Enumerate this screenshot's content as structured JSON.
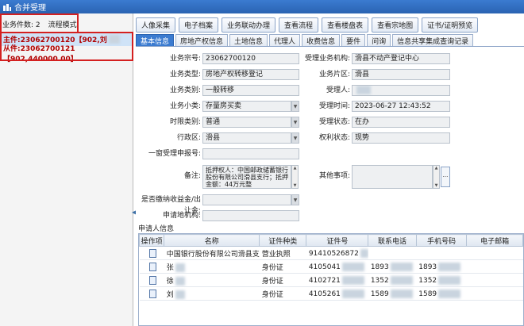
{
  "window": {
    "title": "合并受理"
  },
  "left": {
    "count_label": "业务件数: 2",
    "mode_label": "流程模式:",
    "items": [
      {
        "text": "主件:23062700120【902,刘"
      },
      {
        "text": "从件:23062700121【902,440000.00】"
      }
    ]
  },
  "toolbar": {
    "buttons": [
      "人像采集",
      "电子档案",
      "业务联动办理",
      "查看流程",
      "查看楼盘表",
      "查看宗地图",
      "证书/证明预览"
    ]
  },
  "tabs": [
    "基本信息",
    "房地产权信息",
    "土地信息",
    "代理人",
    "收费信息",
    "要件",
    "问询",
    "信息共享集成查询记录"
  ],
  "form": {
    "ywh_label": "业务宗号:",
    "ywh_value": "23062700120",
    "ywlx_label": "业务类型:",
    "ywlx_value": "房地产权转移登记",
    "ywlb_label": "业务类别:",
    "ywlb_value": "一般转移",
    "ywxl_label": "业务小类:",
    "ywxl_value": "存量房买卖",
    "sxlb_label": "时限类别:",
    "sxlb_value": "普通",
    "xzq_label": "行政区:",
    "xzq_value": "滑县",
    "ycsl_label": "一窗受理申报号:",
    "ycsl_value": "",
    "bz_label": "备注:",
    "bz_value": "抵押权人：中国邮政储蓄银行股份有限公司滑县支行；抵押金额：44万元整",
    "sfjn_label": "是否缴纳收益金/出让金:",
    "sfjn_value": "",
    "sqdjg_label": "申请地机构:",
    "sqdjg_value": "",
    "slywjg_label": "受理业务机构:",
    "slywjg_value": "滑县不动产登记中心",
    "ywpq_label": "业务片区:",
    "ywpq_value": "滑县",
    "slr_label": "受理人:",
    "slr_value": "",
    "slsj_label": "受理时间:",
    "slsj_value": "2023-06-27 12:43:52",
    "slzt_label": "受理状态:",
    "slzt_value": "在办",
    "qlzt_label": "权利状态:",
    "qlzt_value": "现势",
    "qtsx_label": "其他事项:",
    "qtsx_value": ""
  },
  "applicants": {
    "title": "申请人信息",
    "columns": [
      "操作项",
      "名称",
      "证件种类",
      "证件号",
      "联系电话",
      "手机号码",
      "电子邮箱"
    ],
    "rows": [
      {
        "name": "中国银行股份有限公司滑县支",
        "type": "营业执照",
        "id": "91410526872",
        "phone": "",
        "mobile": ""
      },
      {
        "name": "张",
        "type": "身份证",
        "id": "4105041",
        "phone": "1893",
        "mobile": "1893"
      },
      {
        "name": "徐",
        "type": "身份证",
        "id": "4102721",
        "phone": "1352",
        "mobile": "1352"
      },
      {
        "name": "刘",
        "type": "身份证",
        "id": "4105261",
        "phone": "1589",
        "mobile": "1589"
      }
    ]
  }
}
